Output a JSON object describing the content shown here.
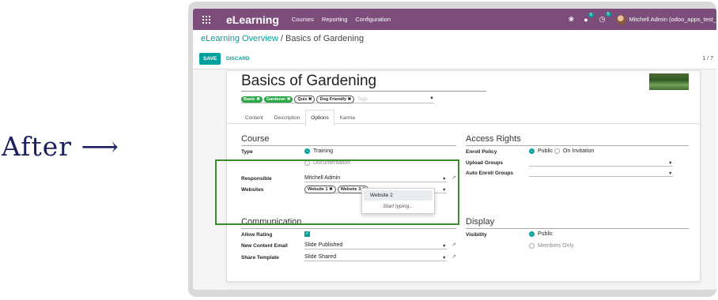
{
  "annotation": {
    "label": "After ⟶"
  },
  "topbar": {
    "app_name": "eLearning",
    "menu": [
      "Courses",
      "Reporting",
      "Configuration"
    ],
    "messages_count": "5",
    "activities_count": "5",
    "user": "Mitchell Admin (odoo_apps_test_"
  },
  "breadcrumb": {
    "parent": "eLearning Overview",
    "separator": "/",
    "current": "Basics of Gardening"
  },
  "buttons": {
    "save": "SAVE",
    "discard": "DISCARD"
  },
  "pager": "1 / 7",
  "course": {
    "title": "Basics of Gardening",
    "tags": [
      {
        "label": "Basic ✖",
        "style": "green"
      },
      {
        "label": "Gardener ✖",
        "style": "green"
      },
      {
        "label": "Quiz ✖",
        "style": "outline"
      },
      {
        "label": "Dog Friendly ✖",
        "style": "outline"
      }
    ],
    "tags_placeholder": "Tags"
  },
  "tabs": [
    "Content",
    "Description",
    "Options",
    "Karma"
  ],
  "active_tab": "Options",
  "course_section": {
    "title": "Course",
    "type_label": "Type",
    "type_options": [
      {
        "label": "Training",
        "selected": true
      },
      {
        "label": "Documentation",
        "selected": false
      }
    ],
    "responsible_label": "Responsible",
    "responsible_value": "Mitchell Admin",
    "websites_label": "Websites",
    "websites": [
      "Website 1 ✖",
      "Website 3 ✖"
    ]
  },
  "websites_dropdown": {
    "items": [
      "Website 2"
    ],
    "hint": "Start typing..."
  },
  "access_section": {
    "title": "Access Rights",
    "enroll_label": "Enroll Policy",
    "enroll_options": [
      {
        "label": "Public",
        "selected": true
      },
      {
        "label": "On Invitation",
        "selected": false
      }
    ],
    "upload_label": "Upload Groups",
    "auto_enroll_label": "Auto Enroll Groups"
  },
  "communication_section": {
    "title": "Communication",
    "allow_rating_label": "Allow Rating",
    "allow_rating": true,
    "new_content_email_label": "New Content Email",
    "new_content_email_value": "Slide Published",
    "share_template_label": "Share Template",
    "share_template_value": "Slide Shared"
  },
  "display_section": {
    "title": "Display",
    "visibility_label": "Visibility",
    "visibility_options": [
      {
        "label": "Public",
        "selected": true
      },
      {
        "label": "Members Only",
        "selected": false
      }
    ]
  },
  "colors": {
    "brand": "#7c4d7b",
    "accent": "#00a09d",
    "highlight_box": "#3c8a2e"
  }
}
